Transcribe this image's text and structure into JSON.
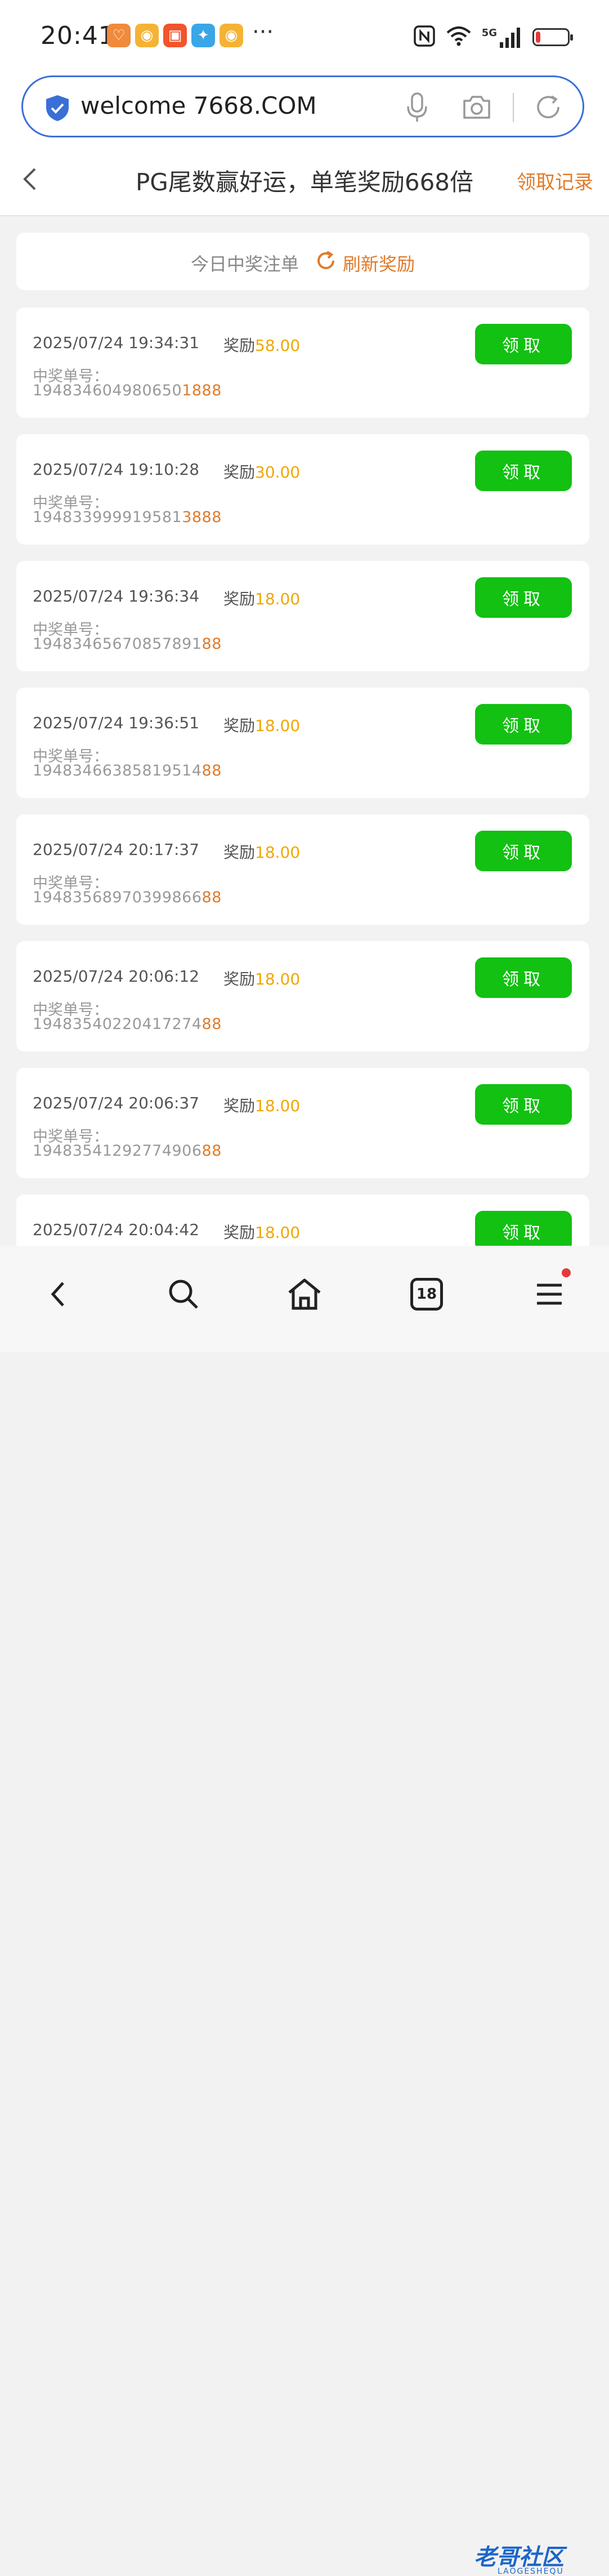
{
  "status_bar": {
    "time": "20:41",
    "more": "···",
    "network": "5G",
    "battery_level": 0.15,
    "app_icons": [
      {
        "icon": "heart-app-icon",
        "color": "#f08a3c",
        "glyph": "♡"
      },
      {
        "icon": "weibo-icon",
        "color": "#f5b335",
        "glyph": "◉"
      },
      {
        "icon": "kuaishou-icon",
        "color": "#f2542d",
        "glyph": "▣"
      },
      {
        "icon": "colorful-app-icon",
        "color": "#3aa6e8",
        "glyph": "✦"
      },
      {
        "icon": "weibo-icon",
        "color": "#f5b335",
        "glyph": "◉"
      }
    ]
  },
  "address_bar": {
    "url": "welcome 7668.COM"
  },
  "header": {
    "title": "PG尾数赢好运，单笔奖励668倍",
    "record_link": "领取记录"
  },
  "summary": {
    "label": "今日中奖注单",
    "refresh_label": "刷新奖励"
  },
  "list": {
    "reward_label": "奖励",
    "order_label": "中奖单号：",
    "claim_label": "领取",
    "items": [
      {
        "time": "2025/07/24 19:34:31",
        "amount": "58.00",
        "order_prefix": "194834604980650",
        "order_tail": "1888"
      },
      {
        "time": "2025/07/24 19:10:28",
        "amount": "30.00",
        "order_prefix": "194833999919581",
        "order_tail": "3888"
      },
      {
        "time": "2025/07/24 19:36:34",
        "amount": "18.00",
        "order_prefix": "19483465670857891",
        "order_tail": "88"
      },
      {
        "time": "2025/07/24 19:36:51",
        "amount": "18.00",
        "order_prefix": "19483466385819514",
        "order_tail": "88"
      },
      {
        "time": "2025/07/24 20:17:37",
        "amount": "18.00",
        "order_prefix": "19483568970399866",
        "order_tail": "88"
      },
      {
        "time": "2025/07/24 20:06:12",
        "amount": "18.00",
        "order_prefix": "19483540220417274",
        "order_tail": "88"
      },
      {
        "time": "2025/07/24 20:06:37",
        "amount": "18.00",
        "order_prefix": "19483541292774906",
        "order_tail": "88"
      },
      {
        "time": "2025/07/24 20:04:42",
        "amount": "18.00",
        "order_prefix": "",
        "order_tail": ""
      }
    ]
  },
  "bottom_nav": {
    "tabs_count": "18",
    "watermark": "老哥社区",
    "watermark_sub": "LAOGESHEQU"
  },
  "colors": {
    "accent_orange": "#e07b2a",
    "amount_yellow": "#f0a700",
    "claim_green": "#12c112",
    "address_border": "#3a6fd8"
  }
}
